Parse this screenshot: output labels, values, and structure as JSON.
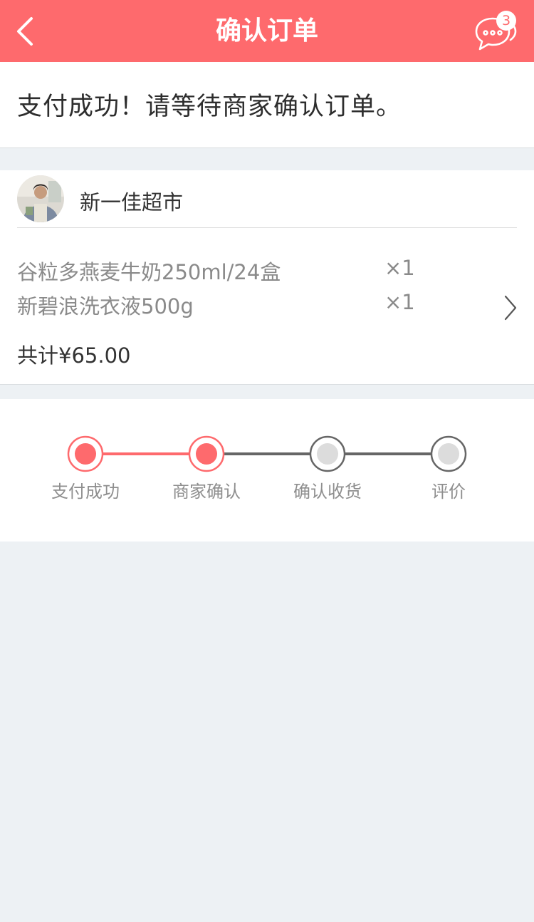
{
  "header": {
    "title": "确认订单",
    "message_badge": "3",
    "back_icon": "chevron-left-icon",
    "message_icon": "chat-bubbles-icon",
    "bg_color": "#fe6a6d"
  },
  "status": {
    "text": "支付成功！请等待商家确认订单。"
  },
  "order": {
    "store_name": "新一佳超市",
    "items": [
      {
        "name": "谷粒多燕麦牛奶250ml/24盒",
        "qty": "×1"
      },
      {
        "name": "新碧浪洗衣液500g",
        "qty": "×1"
      }
    ],
    "total": "共计¥65.00"
  },
  "progress": {
    "steps": [
      {
        "label": "支付成功",
        "done": true
      },
      {
        "label": "商家确认",
        "done": true
      },
      {
        "label": "确认收货",
        "done": false
      },
      {
        "label": "评价",
        "done": false
      }
    ],
    "active_color": "#fe6a6d",
    "inactive_color": "#666666"
  }
}
